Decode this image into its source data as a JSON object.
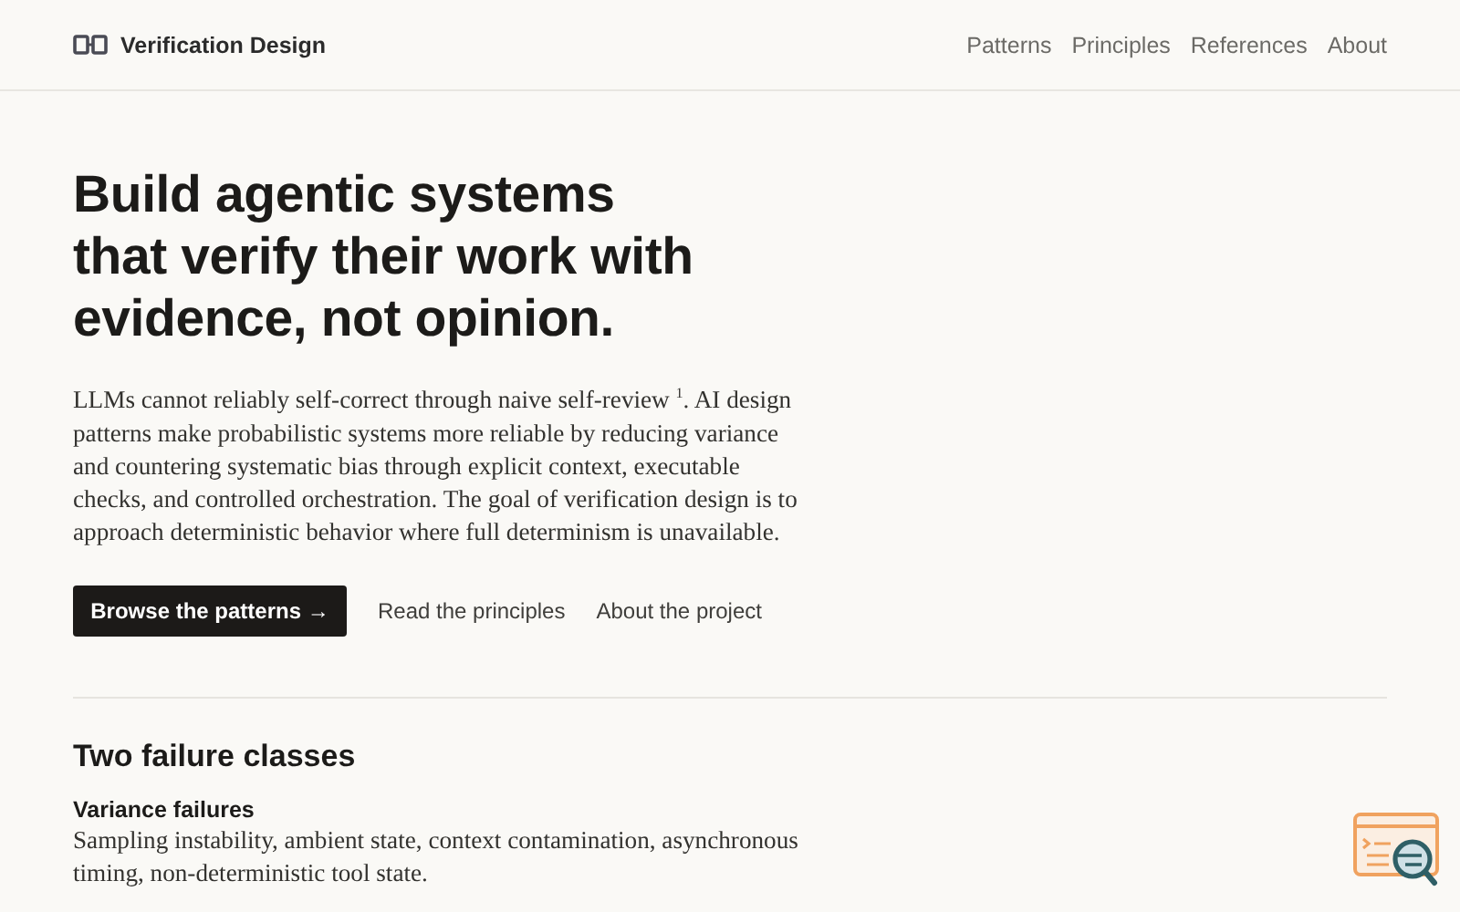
{
  "header": {
    "logo_text": "Verification Design",
    "nav": [
      {
        "label": "Patterns"
      },
      {
        "label": "Principles"
      },
      {
        "label": "References"
      },
      {
        "label": "About"
      }
    ]
  },
  "hero": {
    "headline_lines": [
      "Build agentic systems",
      "that verify their work with",
      "evidence, not opinion."
    ],
    "intro": "LLMs cannot reliably self-correct through naive self-review $^{1}$. AI design patterns make probabilistic systems more reliable by reducing variance and countering systematic bias through explicit context, executable checks, and controlled orchestration. The goal of verification design is to approach deterministic behavior where full determinism is unavailable.",
    "actions": [
      {
        "kind": "primary",
        "label": "Browse the patterns →"
      },
      {
        "kind": "link",
        "label": "Read the principles"
      },
      {
        "kind": "link",
        "label": "About the project"
      }
    ]
  },
  "section": {
    "title": "Two failure classes",
    "items": [
      {
        "title": "Variance failures",
        "text": "Sampling instability, ambient state, context contamination, asynchronous timing, non-deterministic tool state."
      }
    ]
  }
}
